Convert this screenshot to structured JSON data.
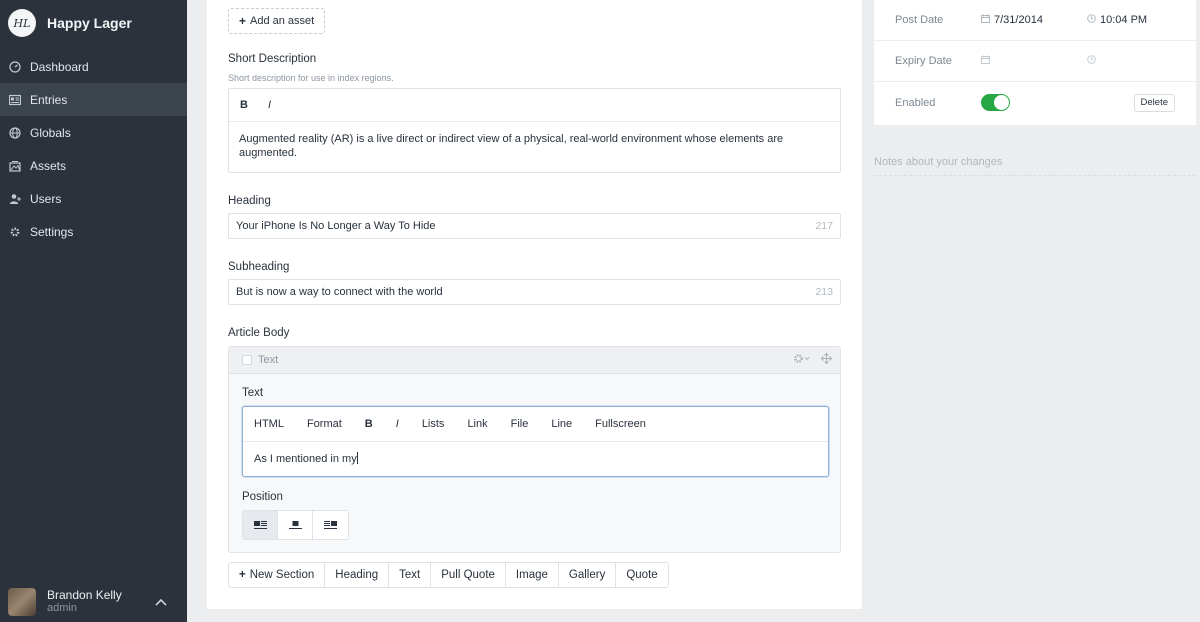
{
  "sidebar": {
    "brand": {
      "logo_text": "HL",
      "name": "Happy Lager"
    },
    "items": [
      {
        "label": "Dashboard",
        "icon": "dashboard-icon"
      },
      {
        "label": "Entries",
        "icon": "entries-icon",
        "active": true
      },
      {
        "label": "Globals",
        "icon": "globe-icon"
      },
      {
        "label": "Assets",
        "icon": "assets-icon"
      },
      {
        "label": "Users",
        "icon": "users-icon"
      },
      {
        "label": "Settings",
        "icon": "gear-icon"
      }
    ],
    "user": {
      "name": "Brandon Kelly",
      "role": "admin"
    }
  },
  "main": {
    "add_asset_label": "Add an asset",
    "short_description": {
      "label": "Short Description",
      "instructions": "Short description for use in index regions.",
      "toolbar": [
        "B",
        "I"
      ],
      "value": "Augmented reality (AR) is a live direct or indirect view of a physical, real-world environment whose elements are augmented."
    },
    "heading": {
      "label": "Heading",
      "value": "Your iPhone Is No Longer a Way To Hide",
      "count": "217"
    },
    "subheading": {
      "label": "Subheading",
      "value": "But is now a way to connect with the world",
      "count": "213"
    },
    "article_body": {
      "label": "Article Body",
      "block_type": "Text",
      "text_label": "Text",
      "toolbar": [
        "HTML",
        "Format",
        "B",
        "I",
        "Lists",
        "Link",
        "File",
        "Line",
        "Fullscreen"
      ],
      "value": "As I mentioned in my",
      "position_label": "Position",
      "position_selected": 0
    },
    "block_buttons": {
      "new_section": "New Section",
      "types": [
        "Heading",
        "Text",
        "Pull Quote",
        "Image",
        "Gallery",
        "Quote"
      ]
    }
  },
  "meta": {
    "post_date": {
      "label": "Post Date",
      "date": "7/31/2014",
      "time": "10:04 PM"
    },
    "expiry_date": {
      "label": "Expiry Date"
    },
    "enabled": {
      "label": "Enabled",
      "on": true,
      "delete_label": "Delete"
    },
    "notes_placeholder": "Notes about your changes"
  },
  "colors": {
    "sidebar_bg": "#2b323b",
    "toggle_on": "#27a844",
    "focus_border": "#8fb1d9"
  }
}
